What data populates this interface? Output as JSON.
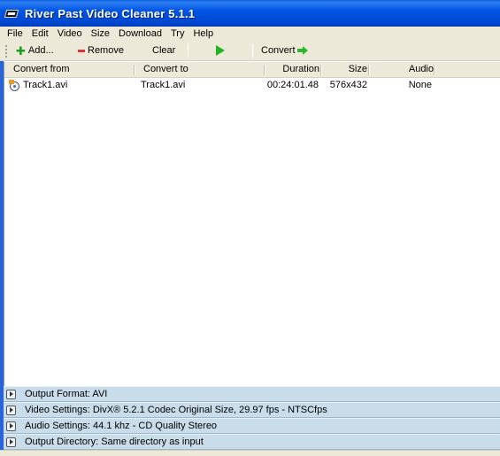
{
  "window": {
    "title": "River Past Video Cleaner 5.1.1"
  },
  "menu": [
    "File",
    "Edit",
    "Video",
    "Size",
    "Download",
    "Try",
    "Help"
  ],
  "toolbar": {
    "add_label": "Add...",
    "remove_label": "Remove",
    "clear_label": "Clear",
    "convert_label": "Convert"
  },
  "list": {
    "columns": [
      "Convert from",
      "Convert to",
      "Duration",
      "Size",
      "Audio"
    ],
    "rows": [
      {
        "from": "Track1.avi",
        "to": "Track1.avi",
        "duration": "00:24:01.48",
        "size": "576x432",
        "audio": "None"
      }
    ]
  },
  "panels": [
    "Output Format: AVI",
    "Video Settings: DivX® 5.2.1 Codec Original Size, 29.97 fps - NTSCfps",
    "Audio Settings: 44.1 khz - CD Quality Stereo",
    "Output Directory: Same directory as input"
  ]
}
